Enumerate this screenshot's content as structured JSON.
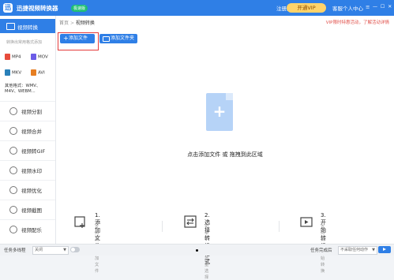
{
  "titlebar": {
    "app_logo": "迅",
    "app_title": "迅捷视频转换器",
    "badge": "极速版",
    "login": "注册/登录",
    "vip": "开通VIP",
    "customer_service": "客服",
    "personal_center": "个人中心",
    "menu": "≡",
    "window_controls": "— ☐ ✕"
  },
  "sidebar": {
    "active": "视频转换",
    "sub_hint": "转换出常用格式添加",
    "formats": [
      "MP4",
      "MOV",
      "MKV",
      "AVI"
    ],
    "multi_format": "其他格式：WMV、M4V、WEBM...",
    "nav": [
      "视频分割",
      "视频合并",
      "视频转GIF",
      "视频水印",
      "视频优化",
      "视频截图",
      "视频配乐"
    ]
  },
  "main": {
    "breadcrumb_home": "首页",
    "breadcrumb_sep": ">",
    "breadcrumb_current": "视频转换",
    "vip_note": "VIP限时特惠活动，了解活动详情",
    "add_file_button": "添加文件",
    "add_folder_button": "添加文件夹",
    "drop_hint": "点击添加文件 或 拖拽到此区域",
    "steps": [
      {
        "title": "1. 添加文件",
        "desc": "支持批量添加文件"
      },
      {
        "title": "2. 选择转换格式",
        "desc": "可单个或者批量选择"
      },
      {
        "title": "3. 开始转换",
        "desc": "支持批量开始转换"
      }
    ]
  },
  "bottombar": {
    "multithread_label": "任务多线程",
    "multithread_value": "关闭",
    "after_task_label": "任务完成后",
    "after_task_value": "不采取任何动作"
  },
  "colors": {
    "accent": "#2f7fe6",
    "vip": "#ffd36a",
    "highlight": "#e43b3b"
  }
}
